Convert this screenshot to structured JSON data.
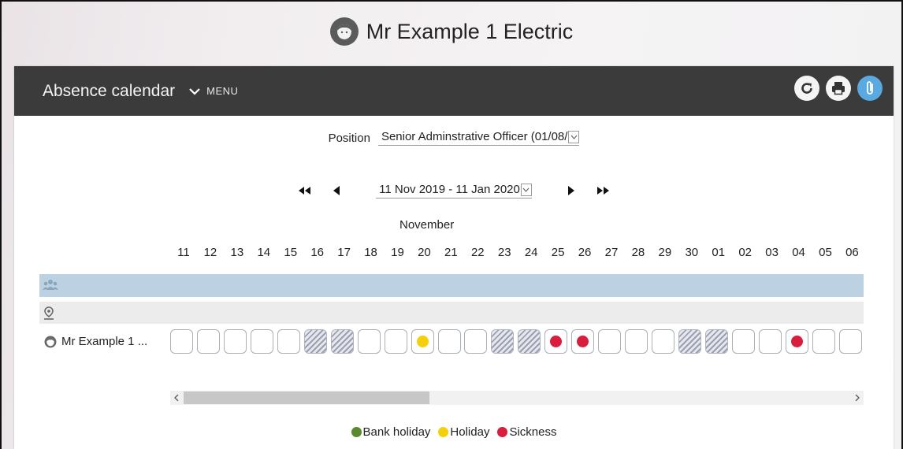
{
  "user": {
    "name": "Mr Example 1 Electric"
  },
  "header": {
    "title": "Absence calendar",
    "menu_label": "MENU",
    "buttons": [
      {
        "icon": "refresh-icon"
      },
      {
        "icon": "print-icon"
      },
      {
        "icon": "attachment-icon"
      }
    ]
  },
  "position": {
    "label": "Position",
    "value": "Senior Adminstrative Officer (01/08/"
  },
  "date_range": {
    "value": "11 Nov 2019 - 11 Jan 2020"
  },
  "calendar": {
    "month": "November",
    "days": [
      "11",
      "12",
      "13",
      "14",
      "15",
      "16",
      "17",
      "18",
      "19",
      "20",
      "21",
      "22",
      "23",
      "24",
      "25",
      "26",
      "27",
      "28",
      "29",
      "30",
      "01",
      "02",
      "03",
      "04",
      "05",
      "06"
    ],
    "person_name": "Mr Example 1 ...",
    "cells": [
      {
        "type": "empty"
      },
      {
        "type": "empty"
      },
      {
        "type": "empty"
      },
      {
        "type": "empty"
      },
      {
        "type": "empty"
      },
      {
        "type": "weekend"
      },
      {
        "type": "weekend"
      },
      {
        "type": "empty"
      },
      {
        "type": "empty"
      },
      {
        "type": "holiday"
      },
      {
        "type": "empty"
      },
      {
        "type": "empty"
      },
      {
        "type": "weekend"
      },
      {
        "type": "weekend"
      },
      {
        "type": "sickness"
      },
      {
        "type": "sickness"
      },
      {
        "type": "empty"
      },
      {
        "type": "empty"
      },
      {
        "type": "empty"
      },
      {
        "type": "weekend"
      },
      {
        "type": "weekend"
      },
      {
        "type": "empty"
      },
      {
        "type": "empty"
      },
      {
        "type": "sickness"
      },
      {
        "type": "empty"
      },
      {
        "type": "empty"
      },
      {
        "type": "weekend"
      }
    ]
  },
  "legend": [
    {
      "label": "Bank holiday",
      "color": "#5b8a2e"
    },
    {
      "label": "Holiday",
      "color": "#f5d00a"
    },
    {
      "label": "Sickness",
      "color": "#d81e3c"
    }
  ],
  "colors": {
    "holiday": "#f5d00a",
    "sickness": "#d81e3c",
    "bank_holiday": "#5b8a2e"
  }
}
